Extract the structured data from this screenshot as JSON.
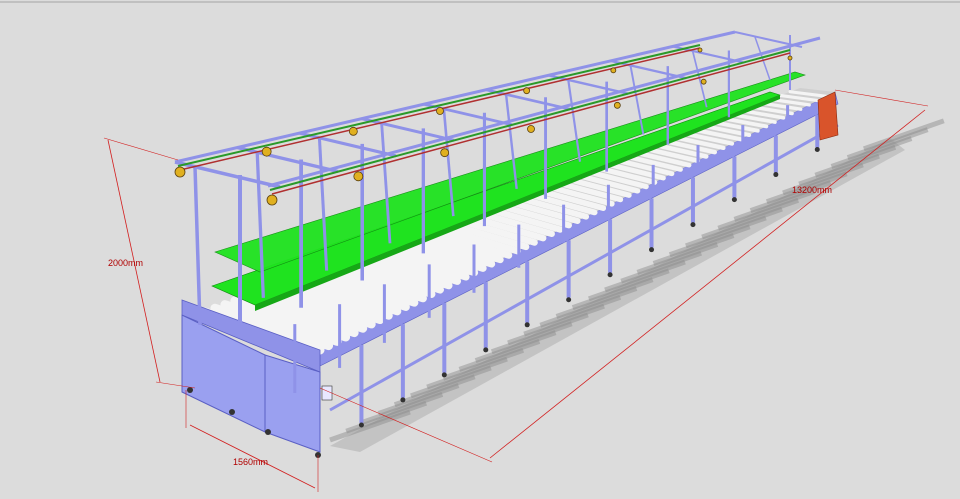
{
  "dimensions": {
    "length": "13200mm",
    "height": "2000mm",
    "width": "1560mm"
  },
  "colors": {
    "background": "#dcdcdc",
    "frame": "#8f92e8",
    "frame_dark": "#5a5fc4",
    "cabinet": "#9aa0f0",
    "shelf": "#1fe31f",
    "roller": "#f4f4f4",
    "shadow": "#8a8a8a",
    "dimension_line": "#d21f1f",
    "end_box": "#d9542b"
  },
  "components": {
    "rollers": 60,
    "lamps": 14,
    "top_frames": 10
  }
}
